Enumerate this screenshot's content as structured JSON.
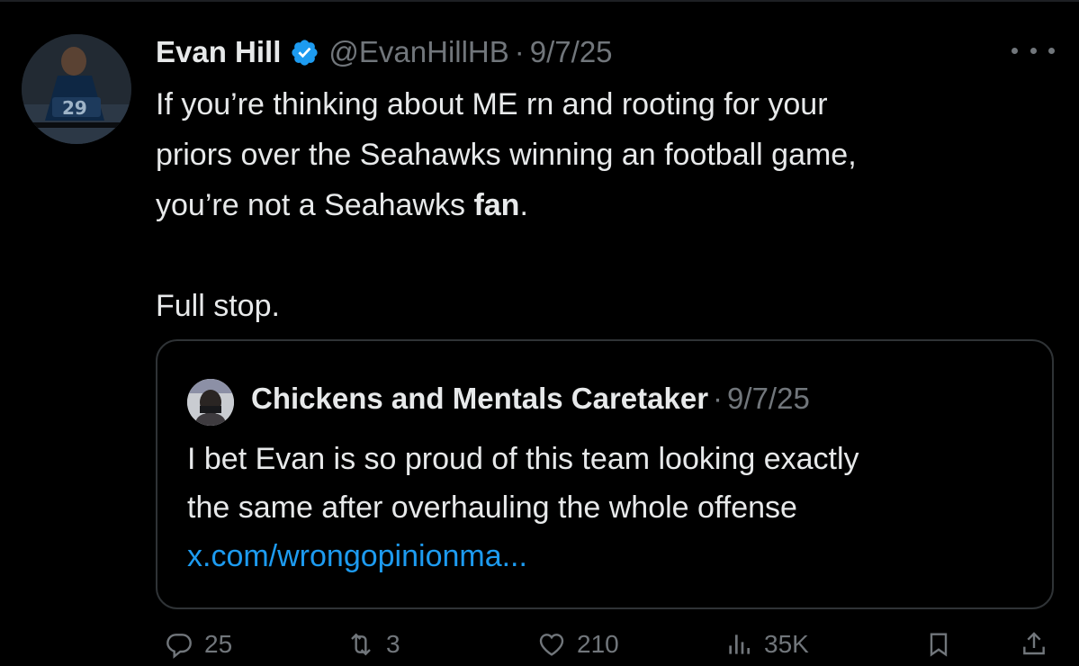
{
  "tweet": {
    "author": {
      "display_name": "Evan Hill",
      "handle": "@EvanHillHB",
      "verified": true,
      "avatar_icon": "football-player-avatar"
    },
    "separator": "·",
    "date": "9/7/25",
    "more_icon": "more-horizontal-icon",
    "text": {
      "line1": "If you’re thinking about ME rn and rooting for your",
      "line2": "priors over the Seahawks winning an football game,",
      "line3_pre": "you’re not a Seahawks ",
      "line3_bold": "fan",
      "line3_post": ".",
      "line4": "Full stop."
    }
  },
  "quote": {
    "author": {
      "display_name": "Chickens and Mentals Caretaker",
      "avatar_icon": "person-avatar"
    },
    "separator": "·",
    "date": "9/7/25",
    "text": {
      "line1": "I bet Evan is so proud of this team looking exactly",
      "line2": "the same after overhauling the whole offense"
    },
    "link": "x.com/wrongopinionma..."
  },
  "actions": {
    "reply": {
      "icon": "reply-icon",
      "count": "25"
    },
    "repost": {
      "icon": "repost-icon",
      "count": "3"
    },
    "like": {
      "icon": "heart-icon",
      "count": "210"
    },
    "views": {
      "icon": "views-icon",
      "count": "35K"
    },
    "bookmark": {
      "icon": "bookmark-icon"
    },
    "share": {
      "icon": "share-icon"
    }
  },
  "colors": {
    "background": "#000000",
    "text": "#e7e9ea",
    "secondary": "#71767b",
    "link": "#1d9bf0",
    "verified": "#1d9bf0",
    "border": "#2f3336"
  }
}
